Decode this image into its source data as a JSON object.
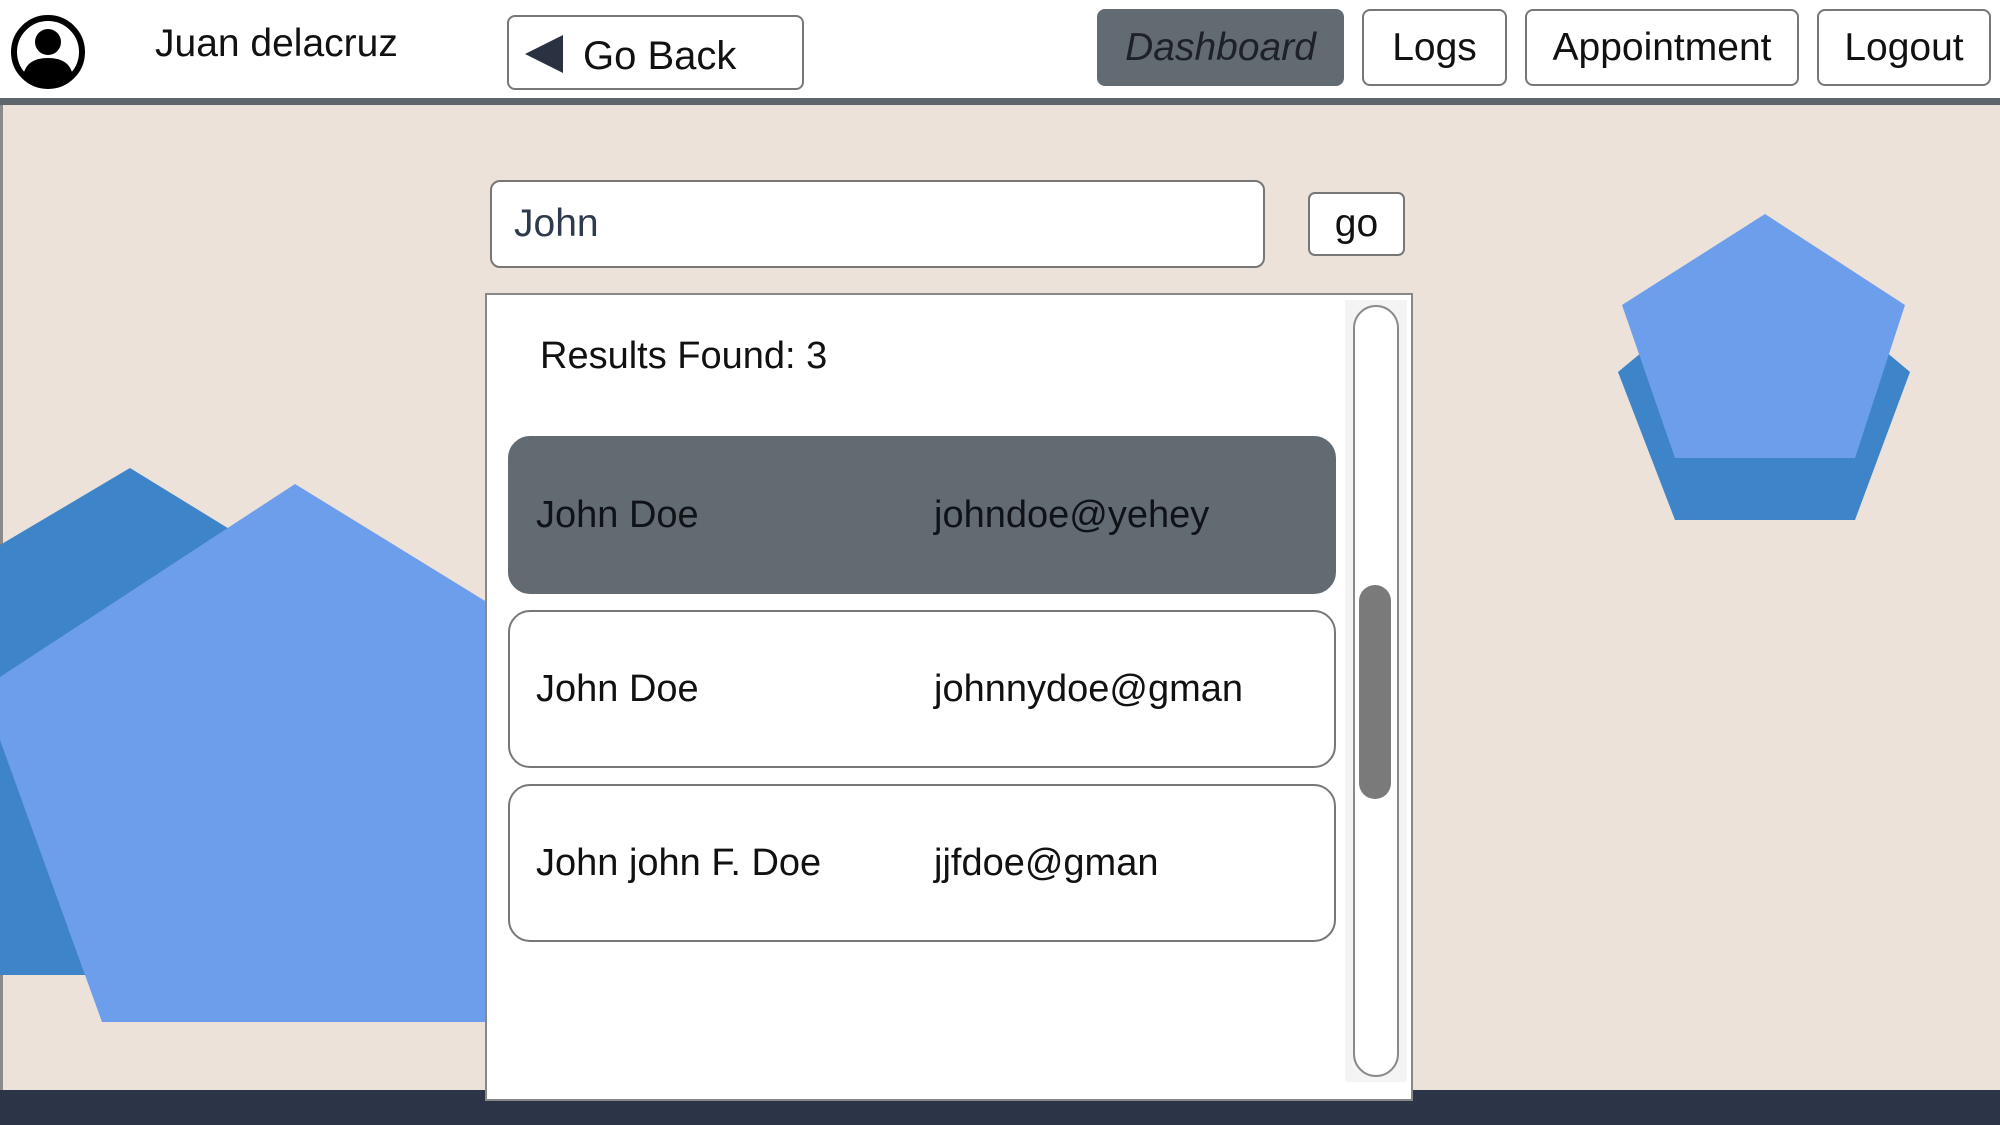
{
  "header": {
    "user_name": "Juan delacruz",
    "avatar_icon": "user-avatar-icon",
    "back_label": "Go Back",
    "back_icon": "back-triangle-icon",
    "nav": {
      "dashboard": "Dashboard",
      "logs": "Logs",
      "appointment": "Appointment",
      "logout": "Logout"
    },
    "active_nav": "Dashboard"
  },
  "search": {
    "value": "John",
    "go_label": "go"
  },
  "results": {
    "count_label": "Results Found: 3",
    "items": [
      {
        "name": "John Doe",
        "email": "johndoe@yehey",
        "selected": true
      },
      {
        "name": "John Doe",
        "email": "johnnydoe@gman",
        "selected": false
      },
      {
        "name": "John john F. Doe",
        "email": "jjfdoe@gman",
        "selected": false
      }
    ]
  },
  "colors": {
    "background": "#ece2da",
    "active_button": "#626a72",
    "shape_dark_blue": "#3d85c8",
    "shape_light_blue": "#6d9eeb",
    "footer": "#2c3447"
  }
}
